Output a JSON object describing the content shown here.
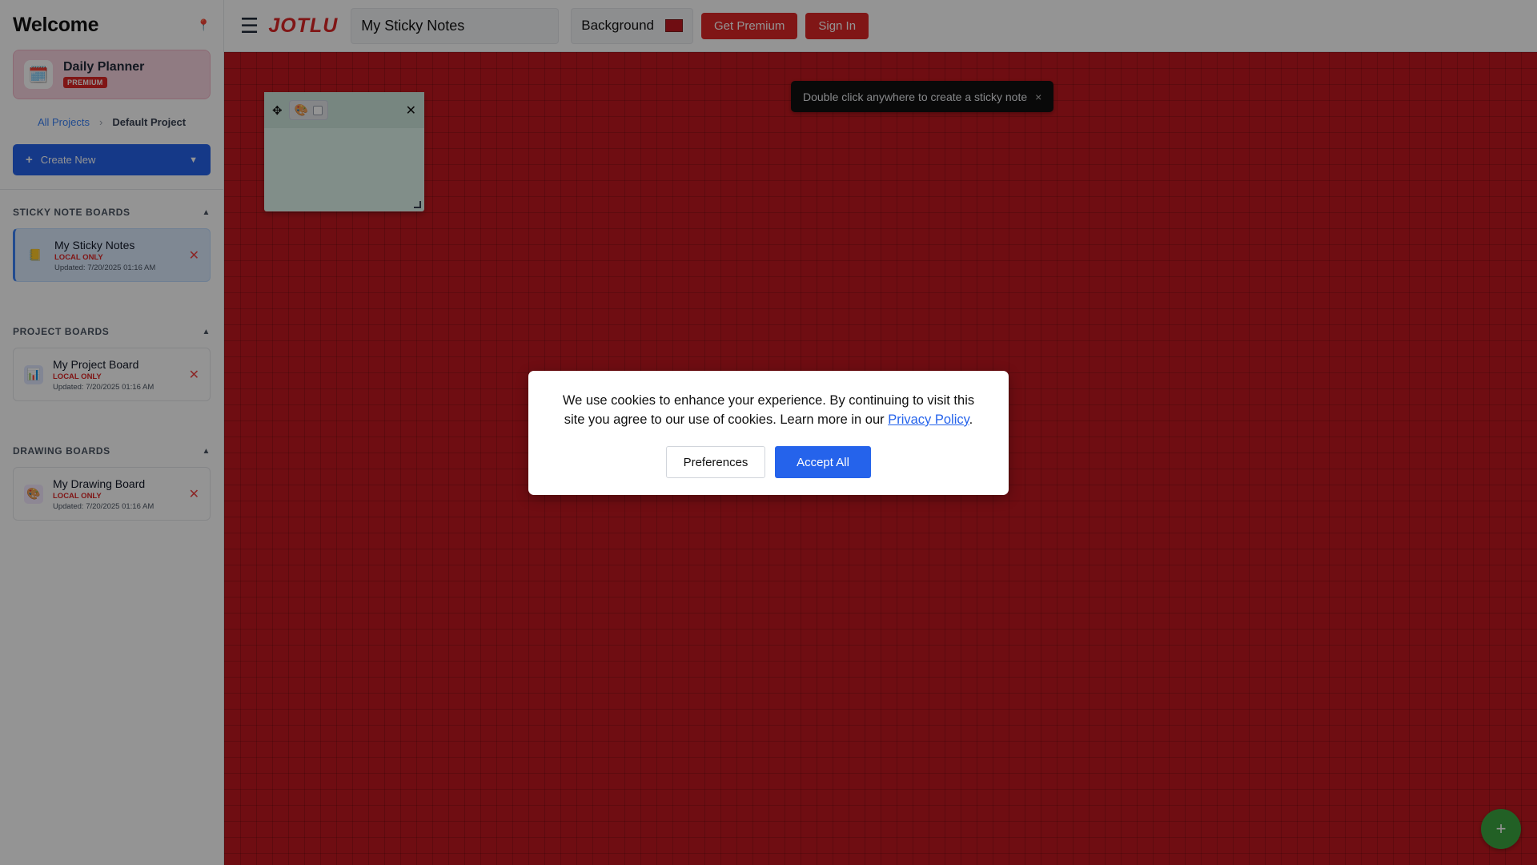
{
  "sidebar": {
    "welcome": "Welcome",
    "planner": {
      "title": "Daily Planner",
      "badge": "PREMIUM"
    },
    "breadcrumb": {
      "all": "All Projects",
      "sep": "›",
      "current": "Default Project"
    },
    "create": {
      "plus": "+",
      "label": "Create New",
      "caret": "▼"
    },
    "sections": [
      {
        "title": "STICKY NOTE BOARDS",
        "toggle": "▲",
        "items": [
          {
            "name": "My Sticky Notes",
            "status": "LOCAL ONLY",
            "updated": "Updated: 7/20/2025 01:16 AM",
            "icon": "📒"
          }
        ]
      },
      {
        "title": "PROJECT BOARDS",
        "toggle": "▲",
        "items": [
          {
            "name": "My Project Board",
            "status": "LOCAL ONLY",
            "updated": "Updated: 7/20/2025 01:16 AM",
            "icon": "📊"
          }
        ]
      },
      {
        "title": "DRAWING BOARDS",
        "toggle": "▲",
        "items": [
          {
            "name": "My Drawing Board",
            "status": "LOCAL ONLY",
            "updated": "Updated: 7/20/2025 01:16 AM",
            "icon": "🎨"
          }
        ]
      }
    ]
  },
  "topbar": {
    "menu_icon": "☰",
    "logo": "JOTLU",
    "board_name": "My Sticky Notes",
    "background_label": "Background",
    "background_color": "#c0181f",
    "get_premium": "Get Premium",
    "sign_in": "Sign In"
  },
  "canvas": {
    "hint": "Double click anywhere to create a sticky note",
    "hint_close": "×",
    "note": {
      "move_icon": "✥",
      "palette_icon": "🎨",
      "close": "✕"
    },
    "fab": "+"
  },
  "cookie": {
    "text_before": "We use cookies to enhance your experience. By continuing to visit this site you agree to our use of cookies. Learn more in our ",
    "link": "Privacy Policy",
    "text_after": ".",
    "preferences": "Preferences",
    "accept": "Accept All"
  }
}
